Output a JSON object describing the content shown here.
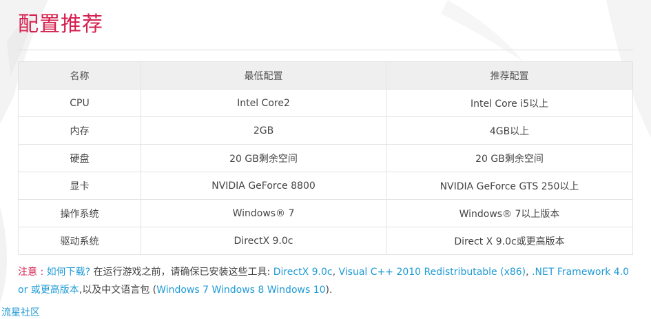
{
  "page": {
    "title": "配置推荐",
    "accent_color": "#d6204f",
    "link_color": "#1f9ad6"
  },
  "table": {
    "headers": [
      "名称",
      "最低配置",
      "推荐配置"
    ],
    "rows": [
      {
        "name": "CPU",
        "min": "Intel Core2",
        "rec": "Intel Core i5以上"
      },
      {
        "name": "内存",
        "min": "2GB",
        "rec": "4GB以上"
      },
      {
        "name": "硬盘",
        "min": "20 GB剩余空间",
        "rec": "20 GB剩余空间"
      },
      {
        "name": "显卡",
        "min": "NVIDIA GeForce 8800",
        "rec": "NVIDIA GeForce GTS 250以上"
      },
      {
        "name": "操作系统",
        "min": "Windows® 7",
        "rec": "Windows® 7以上版本"
      },
      {
        "name": "驱动系统",
        "min": "DirectX 9.0c",
        "rec": "Direct X 9.0c或更高版本"
      }
    ]
  },
  "note": {
    "label": "注意 : ",
    "download_link": "如何下载?",
    "text_before_tools": " 在运行游戏之前，请确保已安装这些工具: ",
    "tool_directx": "DirectX 9.0c",
    "sep1": ", ",
    "tool_vcpp": "Visual C++ 2010 Redistributable (x86)",
    "sep2": ", ",
    "tool_net": ".NET Framework 4.0 or 或更高版本",
    "text_lang": ",以及中文语言包 (",
    "lang_pack": "Windows 7 Windows 8 Windows 10",
    "text_end": ")."
  },
  "footer": {
    "brand": "流星社区"
  }
}
